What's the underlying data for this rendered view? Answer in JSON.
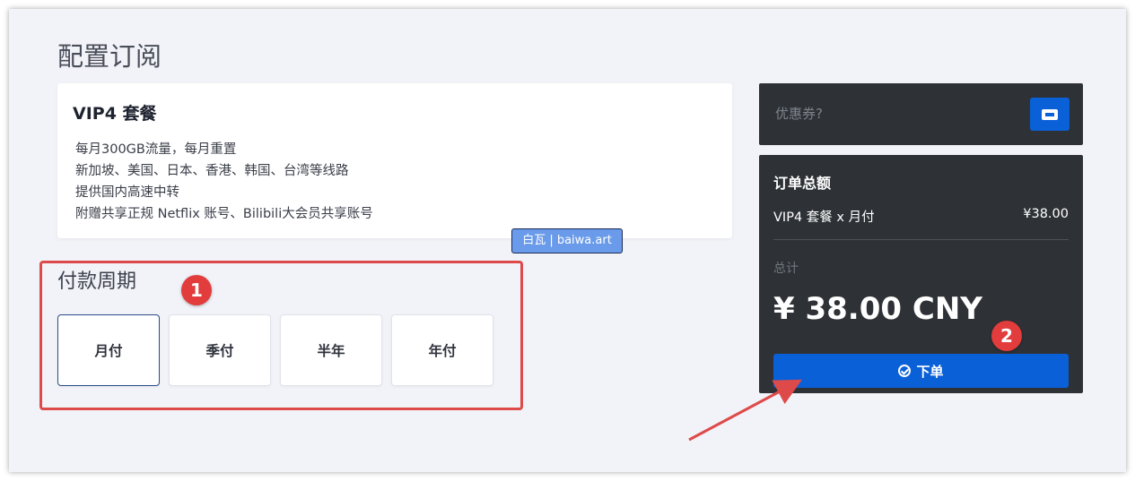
{
  "page": {
    "title": "配置订阅"
  },
  "plan": {
    "name": "VIP4 套餐",
    "features": [
      "每月300GB流量，每月重置",
      "新加坡、美国、日本、香港、韩国、台湾等线路",
      "提供国内高速中转",
      "附赠共享正规 Netflix 账号、Bilibili大会员共享账号"
    ]
  },
  "watermark": "白瓦 | baiwa.art",
  "billing": {
    "title": "付款周期",
    "options": [
      "月付",
      "季付",
      "半年",
      "年付"
    ],
    "selected": "月付"
  },
  "annotations": {
    "badge1": "1",
    "badge2": "2",
    "highlight_color": "#de4a4a"
  },
  "coupon": {
    "placeholder": "优惠券?",
    "icon": "ticket-icon"
  },
  "order": {
    "title": "订单总额",
    "item_label": "VIP4 套餐 x 月付",
    "item_price": "¥38.00",
    "total_label": "总计",
    "total_amount": "¥ 38.00 CNY",
    "submit_label": "下单",
    "submit_icon": "check-circle-icon"
  },
  "colors": {
    "accent": "#0a60d6",
    "panel": "#2e3236",
    "background": "#f2f3f8"
  }
}
